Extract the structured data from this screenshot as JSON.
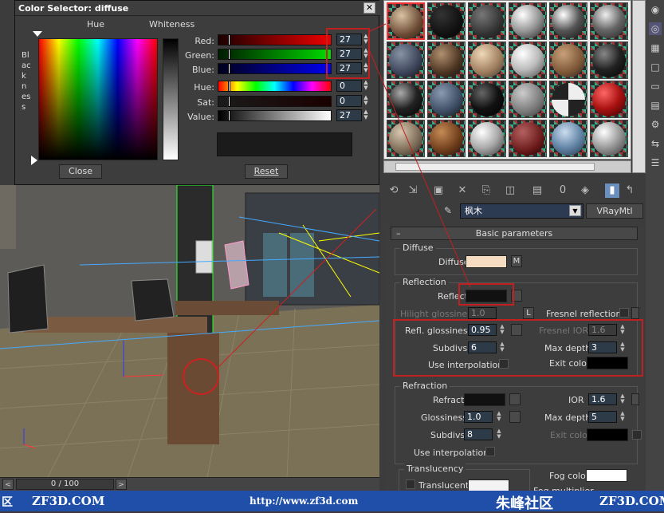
{
  "color_selector": {
    "title": "Color Selector: diffuse",
    "hue_label": "Hue",
    "whiteness_label": "Whiteness",
    "blackness_label": "Blackness",
    "channels": [
      {
        "label": "Red:",
        "value": "27"
      },
      {
        "label": "Green:",
        "value": "27"
      },
      {
        "label": "Blue:",
        "value": "27"
      },
      {
        "label": "Hue:",
        "value": "0"
      },
      {
        "label": "Sat:",
        "value": "0"
      },
      {
        "label": "Value:",
        "value": "27"
      }
    ],
    "close_label": "Close",
    "reset_label": "Reset",
    "current_color": "#1b1b1b"
  },
  "material_editor": {
    "material_name": "枫木",
    "material_type": "VRayMtl",
    "rollout_title": "Basic parameters",
    "diffuse": {
      "group": "Diffuse",
      "label": "Diffuse",
      "map_button": "M",
      "color": "#f5dcc0"
    },
    "reflection": {
      "group": "Reflection",
      "reflect_label": "Reflect",
      "reflect_color": "#111111",
      "hilight_label": "Hilight glossiness",
      "hilight_value": "1.0",
      "lock_label": "L",
      "fresnel_label": "Fresnel reflections",
      "refl_gloss_label": "Refl. glossiness",
      "refl_gloss_value": "0.95",
      "fresnel_ior_label": "Fresnel IOR",
      "fresnel_ior_value": "1.6",
      "subdivs_label": "Subdivs",
      "subdivs_value": "6",
      "max_depth_label": "Max depth",
      "max_depth_value": "3",
      "use_interp_label": "Use interpolation",
      "exit_color_label": "Exit color"
    },
    "refraction": {
      "group": "Refraction",
      "refract_label": "Refract",
      "ior_label": "IOR",
      "ior_value": "1.6",
      "gloss_label": "Glossiness",
      "gloss_value": "1.0",
      "max_depth_label": "Max depth",
      "max_depth_value": "5",
      "subdivs_label": "Subdivs",
      "subdivs_value": "8",
      "exit_color_label": "Exit color",
      "use_interp_label": "Use interpolation",
      "fog_color_label": "Fog color",
      "fog_mult_label": "Fog multiplier"
    },
    "translucency": {
      "group": "Translucency",
      "label": "Translucent"
    }
  },
  "timeline": {
    "frame": "0 / 100",
    "prev": "<",
    "next": ">"
  },
  "watermark": {
    "left_char": "区",
    "left_site": "ZF3D.COM",
    "url": "http://www.zf3d.com",
    "brand": "朱峰社区",
    "right_site": "ZF3D.COM"
  }
}
